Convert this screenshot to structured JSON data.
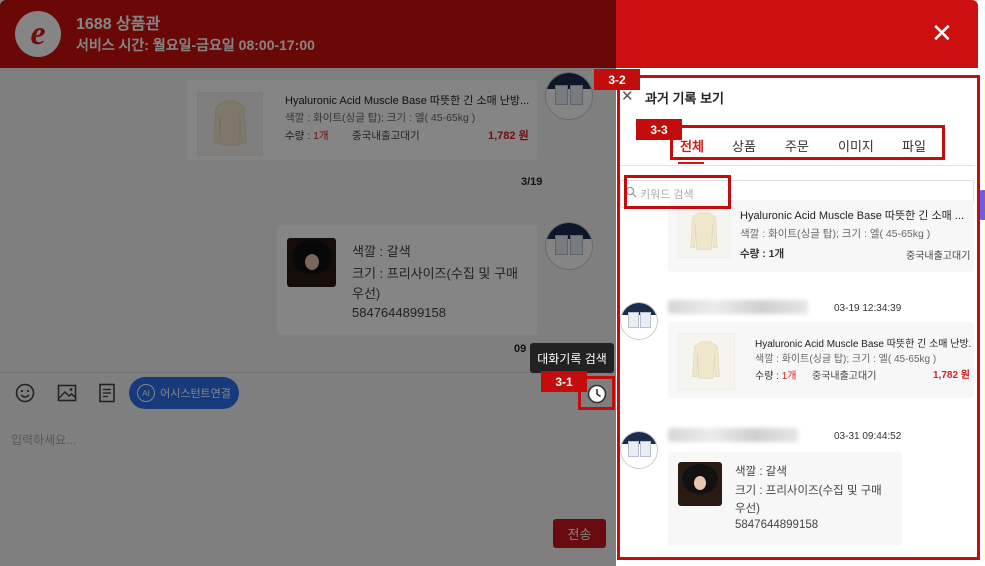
{
  "header": {
    "title": "1688 상품관",
    "hours": "서비스 시간: 월요일-금요일 08:00-17:00",
    "close_icon": "close-icon"
  },
  "chat": {
    "product": {
      "name": "Hyaluronic Acid Muscle Base 따뜻한 긴 소매 난방...",
      "option": "색깔 : 화이트(싱글 탑);  크기 : 엘( 45-65kg )",
      "qty_label": "수량 : ",
      "qty": "1개",
      "tag": "중국내출고대기",
      "price": "1,782 원"
    },
    "page_info": "3/19",
    "msg2": {
      "color": "색깔 : 갈색",
      "size": "크기 : 프리사이즈(수집 및 구매",
      "size2": "우선)",
      "code": "5847644899158"
    },
    "time_partial": "09",
    "tooltip": "대화기록 검색",
    "ai_button": "어시스턴트연결",
    "ai_icon_text": "AI",
    "input_placeholder": "입력하세요...",
    "send": "전송"
  },
  "panel": {
    "title": "과거 기록 보기",
    "tabs": [
      "전체",
      "상품",
      "주문",
      "이미지",
      "파일"
    ],
    "active_tab": "전체",
    "search_placeholder": "키워드 검색",
    "item1": {
      "name": "Hyaluronic Acid Muscle Base 따뜻한 긴 소매 ...",
      "option": "색깔 : 화이트(싱글 탑);  크기 : 엘( 45-65kg )",
      "qty": "수량 : 1개",
      "tag": "중국내출고대기"
    },
    "item2": {
      "time": "03-19 12:34:39",
      "name": "Hyaluronic Acid Muscle Base 따뜻한 긴 소매 난방...",
      "option": "색깔 : 화이트(싱글 탑);  크기 : 엘( 45-65kg )",
      "qty_label": "수량 : ",
      "qty": "1개",
      "tag": "중국내출고대기",
      "price": "1,782 원"
    },
    "item3": {
      "time": "03-31 09:44:52",
      "color": "색깔 : 갈색",
      "size": "크기 : 프리사이즈(수집 및 구매",
      "size2": "우선)",
      "code": "5847644899158"
    }
  },
  "annotations": [
    "3-1",
    "3-2",
    "3-3"
  ],
  "colors": {
    "brand_red": "#cc1010",
    "annotation_red": "#c30d0d",
    "ai_blue": "#2d6ff0",
    "active_tab": "#d01818"
  }
}
